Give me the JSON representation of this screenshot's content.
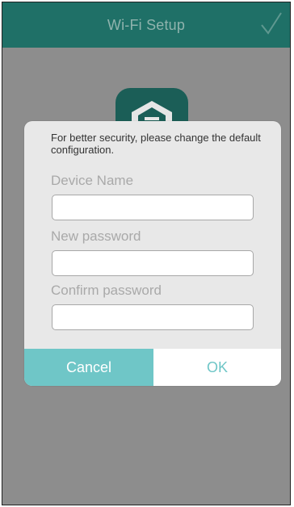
{
  "header": {
    "title": "Wi-Fi Setup",
    "confirm_icon": "checkmark-icon"
  },
  "app_icon": {
    "name": "router-app-icon"
  },
  "dialog": {
    "message": "For better security, please change the default configuration.",
    "fields": [
      {
        "label": "Device Name",
        "value": "",
        "placeholder": ""
      },
      {
        "label": "New password",
        "value": "",
        "placeholder": ""
      },
      {
        "label": "Confirm password",
        "value": "",
        "placeholder": ""
      }
    ],
    "cancel_label": "Cancel",
    "ok_label": "OK"
  },
  "colors": {
    "header_bg": "#1f7067",
    "accent": "#6fc6c7",
    "overlay": "#8d8d8d",
    "dialog_bg": "#e8e8e8"
  }
}
